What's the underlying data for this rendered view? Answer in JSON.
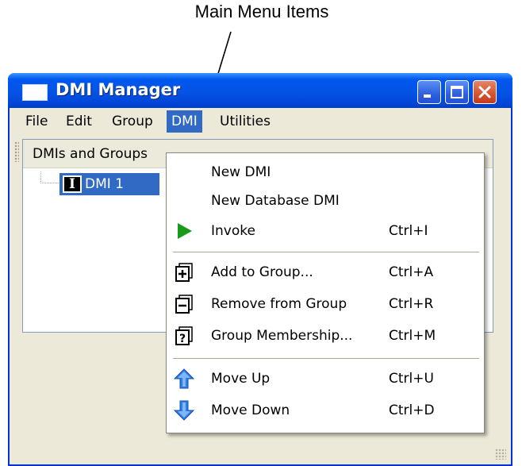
{
  "annotation": {
    "text": "Main Menu Items"
  },
  "window": {
    "title": "DMI Manager"
  },
  "titlebar_buttons": [
    "minimize",
    "maximize",
    "close"
  ],
  "menubar": {
    "items": [
      {
        "label": "File",
        "active": false
      },
      {
        "label": "Edit",
        "active": false
      },
      {
        "label": "Group",
        "active": false
      },
      {
        "label": "DMI",
        "active": true
      },
      {
        "label": "Utilities",
        "active": false
      }
    ]
  },
  "toolbar": {
    "icons": [
      "lock-icon",
      "invoke-icon",
      "edit-icon",
      "delete-icon"
    ]
  },
  "tree": {
    "header": "DMIs and Groups",
    "nodes": [
      {
        "label": "DMI 1",
        "icon": "dmi-icon",
        "selected": true
      }
    ]
  },
  "dmi_menu": {
    "items": [
      {
        "label": "New DMI",
        "shortcut": "",
        "icon": ""
      },
      {
        "label": "New Database DMI",
        "shortcut": "",
        "icon": ""
      },
      {
        "label": "Invoke",
        "shortcut": "Ctrl+I",
        "icon": "invoke-icon"
      },
      {
        "label": "Add to Group...",
        "shortcut": "Ctrl+A",
        "icon": "add-to-group-icon"
      },
      {
        "label": "Remove from Group",
        "shortcut": "Ctrl+R",
        "icon": "remove-from-group-icon"
      },
      {
        "label": "Group Membership...",
        "shortcut": "Ctrl+M",
        "icon": "group-membership-icon"
      },
      {
        "label": "Move Up",
        "shortcut": "Ctrl+U",
        "icon": "move-up-icon"
      },
      {
        "label": "Move Down",
        "shortcut": "Ctrl+D",
        "icon": "move-down-icon"
      }
    ]
  },
  "colors": {
    "titlebar": "#0553e5",
    "selection": "#316ac5",
    "window_face": "#ece9d8",
    "invoke_green": "#1a9a1a",
    "close_red": "#d6532e",
    "arrow_blue": "#2f7ee8"
  }
}
